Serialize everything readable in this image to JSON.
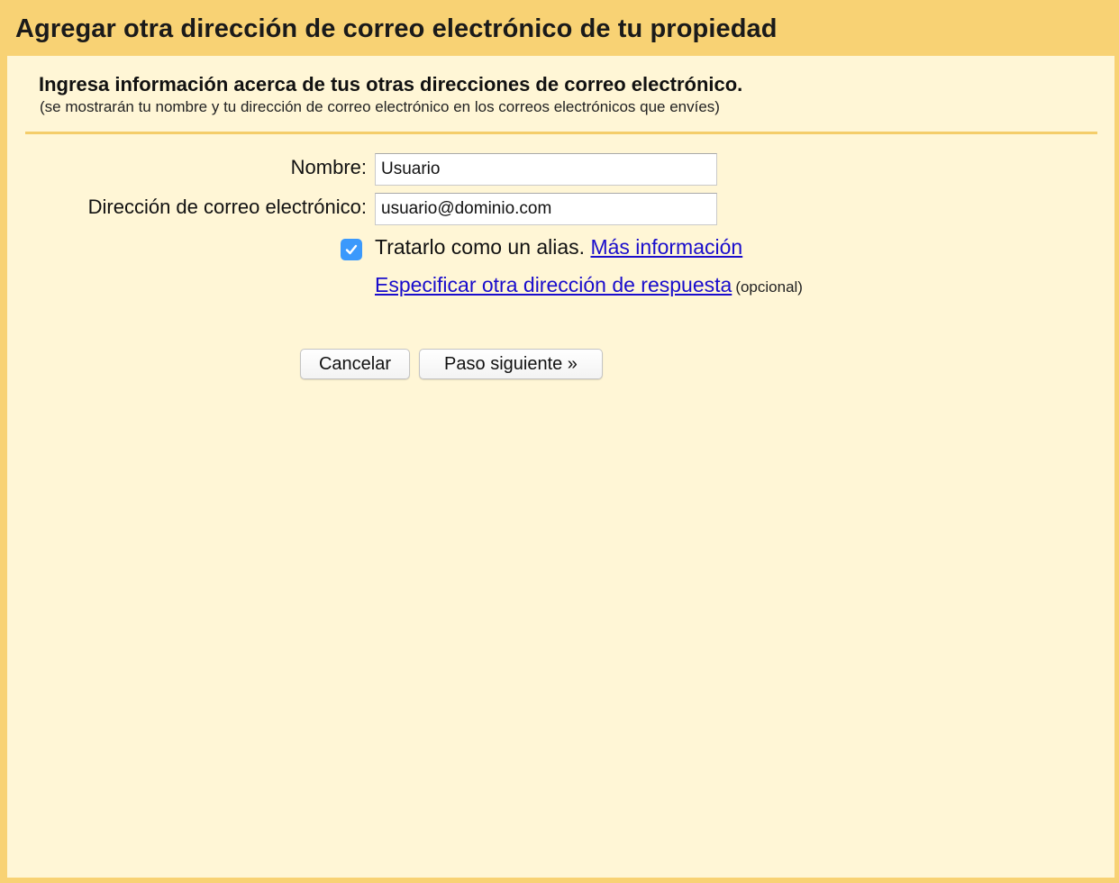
{
  "dialog": {
    "title": "Agregar otra dirección de correo electrónico de tu propiedad",
    "heading": "Ingresa información acerca de tus otras direcciones de correo electrónico.",
    "subheading": "(se mostrarán tu nombre y tu dirección de correo electrónico en los correos electrónicos que envíes)"
  },
  "form": {
    "name_label": "Nombre:",
    "name_value": "Usuario",
    "email_label": "Dirección de correo electrónico:",
    "email_value": "usuario@dominio.com",
    "alias_checked": true,
    "alias_label": "Tratarlo como un alias.",
    "more_info_link": "Más información",
    "reply_link": "Especificar otra dirección de respuesta",
    "optional_note": "(opcional)"
  },
  "buttons": {
    "cancel": "Cancelar",
    "next": "Paso siguiente »"
  },
  "colors": {
    "title_bar": "#f8d274",
    "body": "#fff6d6",
    "link": "#1a0dcc",
    "checkbox": "#3b99fc"
  },
  "icons": {
    "checkbox": "checkmark-icon"
  }
}
